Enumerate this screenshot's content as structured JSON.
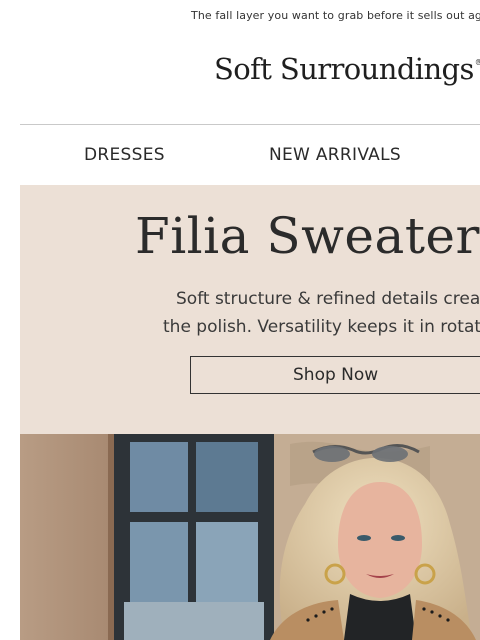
{
  "preheader": {
    "text": "The fall layer you want to grab before it sells out again."
  },
  "logo": {
    "text": "Soft Surroundings",
    "reg_mark": "®"
  },
  "nav": {
    "items": [
      {
        "label": "DRESSES"
      },
      {
        "label": "NEW ARRIVALS"
      }
    ]
  },
  "hero": {
    "title": "Filia Sweater Vest",
    "copy_line1": "Soft structure & refined details create",
    "copy_line2": "the polish. Versatility keeps it in rotation.",
    "cta_label": "Shop Now",
    "background_color": "#ece0d6"
  }
}
